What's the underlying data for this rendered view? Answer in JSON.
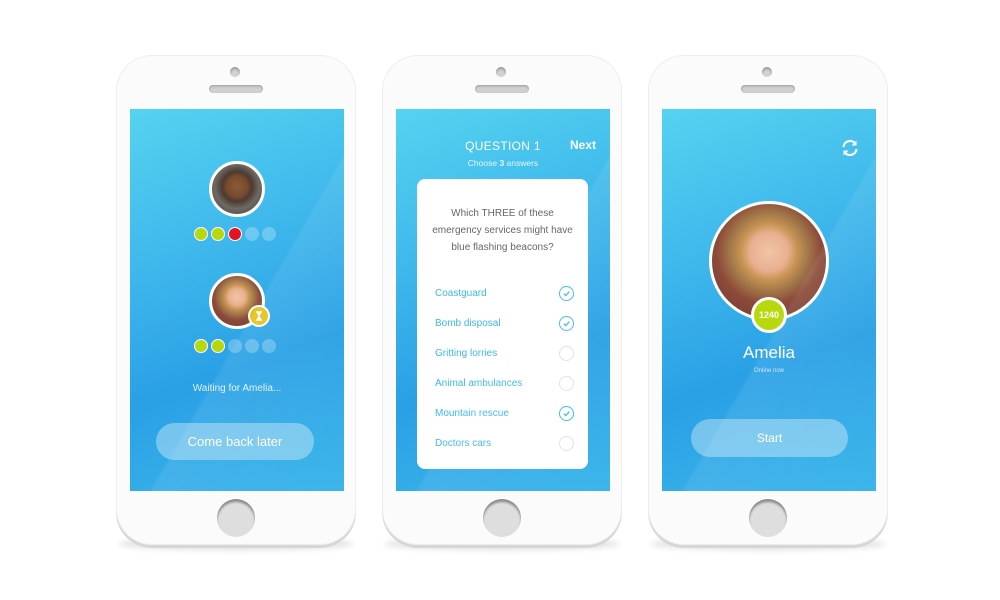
{
  "screens": {
    "waiting": {
      "opponent_score_dots": [
        "green",
        "green",
        "red",
        "empty",
        "empty"
      ],
      "player_score_dots": [
        "green",
        "green",
        "empty",
        "empty",
        "empty"
      ],
      "status_text": "Waiting for Amelia...",
      "button_label": "Come back later"
    },
    "question": {
      "title": "QUESTION 1",
      "next_label": "Next",
      "subtitle_prefix": "Choose ",
      "subtitle_count": "3",
      "subtitle_suffix": " answers",
      "question_text": "Which THREE of these emergency services might have blue flashing beacons?",
      "answers": [
        {
          "label": "Coastguard",
          "checked": true
        },
        {
          "label": "Bomb disposal",
          "checked": true
        },
        {
          "label": "Gritting lorries",
          "checked": false
        },
        {
          "label": "Animal ambulances",
          "checked": false
        },
        {
          "label": "Mountain rescue",
          "checked": true
        },
        {
          "label": "Doctors cars",
          "checked": false
        }
      ]
    },
    "profile": {
      "score": "1240",
      "name": "Amelia",
      "status": "Online now",
      "button_label": "Start"
    }
  },
  "colors": {
    "accent": "#3bb8e8",
    "correct": "#b8d80e",
    "wrong": "#e31320",
    "waiting_badge": "#e3c11a"
  }
}
